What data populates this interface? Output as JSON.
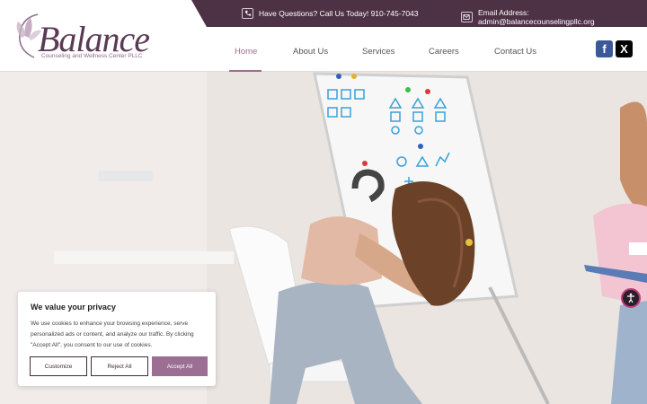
{
  "topbar": {
    "phone_text": "Have Questions? Call Us Today! 910-745-7043",
    "email_text": "Email Address: admin@balancecounselingpllc.org",
    "phone_icon": "phone-icon",
    "email_icon": "envelope-icon"
  },
  "logo": {
    "word": "Balance",
    "subtitle": "Counseling and Wellness Center PLLC"
  },
  "nav": {
    "items": [
      {
        "label": "Home",
        "active": true
      },
      {
        "label": "About Us",
        "active": false
      },
      {
        "label": "Services",
        "active": false
      },
      {
        "label": "Careers",
        "active": false
      },
      {
        "label": "Contact Us",
        "active": false
      }
    ]
  },
  "social": {
    "facebook": "f",
    "x": "X"
  },
  "cookie": {
    "title": "We value your privacy",
    "body": "We use cookies to enhance your browsing experience, serve personalized ads or content, and analyze our traffic. By clicking \"Accept All\", you consent to our use of cookies.",
    "customize": "Customize",
    "reject": "Reject All",
    "accept": "Accept All"
  },
  "colors": {
    "brand": "#4d3145",
    "accent": "#9a6f93"
  }
}
